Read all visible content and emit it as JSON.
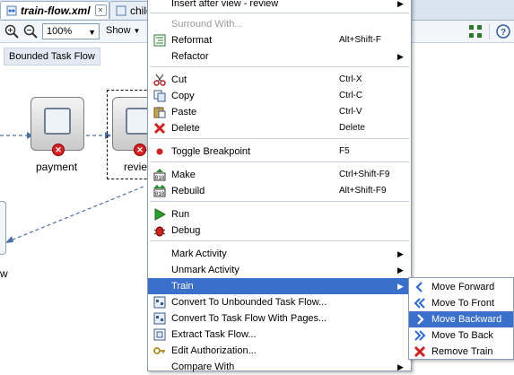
{
  "editor": {
    "tabs": [
      {
        "label": "train-flow.xml",
        "active": true
      },
      {
        "label": "child",
        "active": false
      }
    ],
    "toolbar": {
      "zoom_value": "100%",
      "show_label": "Show"
    },
    "flow_label": "Bounded Task Flow",
    "activities": [
      {
        "label": "payment"
      },
      {
        "label": "review"
      }
    ],
    "left_label": "w"
  },
  "context_menu": {
    "items": [
      {
        "label": "Insert after view - review",
        "shortcut": "",
        "submenu": true
      },
      {
        "label": "Surround With...",
        "shortcut": "",
        "disabled": true
      },
      {
        "label": "Reformat",
        "shortcut": "Alt+Shift-F"
      },
      {
        "label": "Refactor",
        "shortcut": "",
        "submenu": true
      },
      {
        "label": "Cut",
        "shortcut": "Ctrl-X"
      },
      {
        "label": "Copy",
        "shortcut": "Ctrl-C"
      },
      {
        "label": "Paste",
        "shortcut": "Ctrl-V"
      },
      {
        "label": "Delete",
        "shortcut": "Delete"
      },
      {
        "label": "Toggle Breakpoint",
        "shortcut": "F5"
      },
      {
        "label": "Make",
        "shortcut": "Ctrl+Shift-F9"
      },
      {
        "label": "Rebuild",
        "shortcut": "Alt+Shift-F9"
      },
      {
        "label": "Run",
        "shortcut": ""
      },
      {
        "label": "Debug",
        "shortcut": ""
      },
      {
        "label": "Mark Activity",
        "shortcut": "",
        "submenu": true
      },
      {
        "label": "Unmark Activity",
        "shortcut": "",
        "submenu": true
      },
      {
        "label": "Train",
        "shortcut": "",
        "submenu": true,
        "highlighted": true
      },
      {
        "label": "Convert To Unbounded Task Flow...",
        "shortcut": ""
      },
      {
        "label": "Convert To Task Flow With Pages...",
        "shortcut": ""
      },
      {
        "label": "Extract Task Flow...",
        "shortcut": ""
      },
      {
        "label": "Edit Authorization...",
        "shortcut": ""
      },
      {
        "label": "Compare With",
        "shortcut": "",
        "submenu": true
      }
    ]
  },
  "train_submenu": {
    "items": [
      {
        "label": "Move Forward"
      },
      {
        "label": "Move To Front"
      },
      {
        "label": "Move Backward",
        "highlighted": true
      },
      {
        "label": "Move To Back"
      },
      {
        "label": "Remove Train"
      }
    ]
  },
  "colors": {
    "highlight": "#3a6fcb",
    "tab_bar": "#d9e4f1",
    "error": "#d72020"
  }
}
